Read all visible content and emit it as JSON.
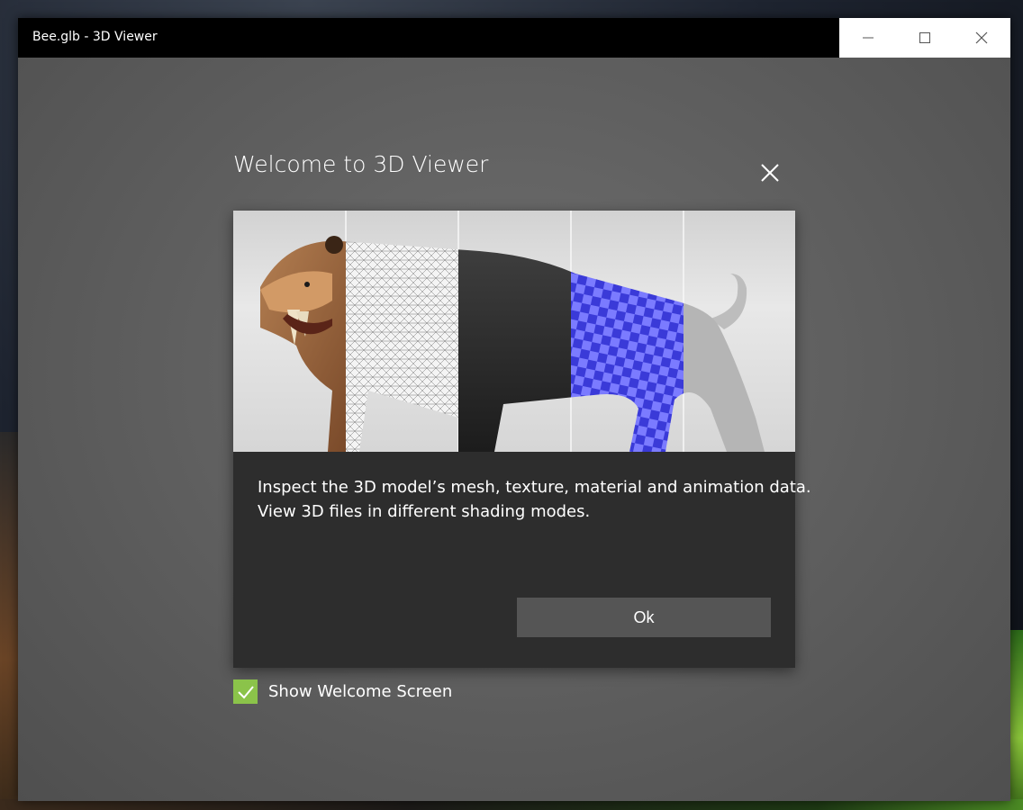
{
  "window": {
    "title": "Bee.glb - 3D Viewer",
    "minimize_icon": "minimize-icon",
    "maximize_icon": "maximize-icon",
    "close_icon": "close-icon"
  },
  "dialog": {
    "title": "Welcome to 3D Viewer",
    "close_icon": "close-icon",
    "description_line1": "Inspect the 3D model’s mesh, texture, material and animation data.",
    "description_line2": "View 3D files in different shading modes.",
    "ok_label": "Ok",
    "show_welcome_label": "Show Welcome Screen",
    "show_welcome_checked": true
  },
  "colors": {
    "accent": "#8bc34a",
    "card_background": "#2d2d2d",
    "button_background": "#555555",
    "titlebar": "#000000"
  }
}
